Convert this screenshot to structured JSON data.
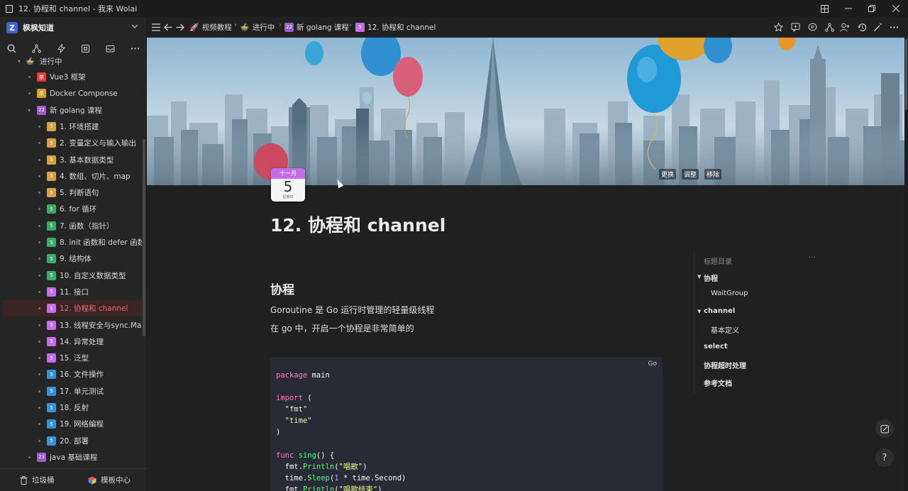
{
  "window": {
    "title": "12. 协程和 channel - 我来 Wolai",
    "controls": [
      "layout-icon",
      "minimize-icon",
      "restore-icon",
      "close-icon"
    ]
  },
  "sidebar": {
    "workspace_name": "枫枫知道",
    "partial_top_item": "进行中",
    "items": [
      {
        "label": "Vue3 框架",
        "icon_color": "#e23d3d",
        "icon_text": "禁"
      },
      {
        "label": "Docker Componse",
        "icon_color": "#c9a227",
        "icon_text": "奖"
      },
      {
        "label": "新 golang 课程",
        "icon_color": "#9b5cc9",
        "icon_text": "22"
      },
      {
        "label": "1. 环境搭建",
        "icon_color": "#d4a24a",
        "icon_text": "5"
      },
      {
        "label": "2. 变量定义与输入输出",
        "icon_color": "#d4a24a",
        "icon_text": "5"
      },
      {
        "label": "3. 基本数据类型",
        "icon_color": "#d4a24a",
        "icon_text": "5"
      },
      {
        "label": "4. 数组、切片、map",
        "icon_color": "#d4a24a",
        "icon_text": "5"
      },
      {
        "label": "5. 判断语句",
        "icon_color": "#d4a24a",
        "icon_text": "5"
      },
      {
        "label": "6. for 循环",
        "icon_color": "#3fa86a",
        "icon_text": "5"
      },
      {
        "label": "7. 函数（指针）",
        "icon_color": "#3fa86a",
        "icon_text": "5"
      },
      {
        "label": "8. init 函数和 defer 函数",
        "icon_color": "#3fa86a",
        "icon_text": "5"
      },
      {
        "label": "9. 结构体",
        "icon_color": "#3fa86a",
        "icon_text": "5"
      },
      {
        "label": "10. 自定义数据类型",
        "icon_color": "#3fa86a",
        "icon_text": "5"
      },
      {
        "label": "11. 接口",
        "icon_color": "#c36ee6",
        "icon_text": "5"
      },
      {
        "label": "12. 协程和 channel",
        "icon_color": "#c36ee6",
        "icon_text": "5"
      },
      {
        "label": "13. 线程安全与sync.Map",
        "icon_color": "#c36ee6",
        "icon_text": "5"
      },
      {
        "label": "14. 异常处理",
        "icon_color": "#c36ee6",
        "icon_text": "5"
      },
      {
        "label": "15. 泛型",
        "icon_color": "#c36ee6",
        "icon_text": "5"
      },
      {
        "label": "16. 文件操作",
        "icon_color": "#3d8fd6",
        "icon_text": "5"
      },
      {
        "label": "17. 单元测试",
        "icon_color": "#3d8fd6",
        "icon_text": "5"
      },
      {
        "label": "18. 反射",
        "icon_color": "#3d8fd6",
        "icon_text": "5"
      },
      {
        "label": "19. 网络编程",
        "icon_color": "#3d8fd6",
        "icon_text": "5"
      },
      {
        "label": "20. 部署",
        "icon_color": "#3d8fd6",
        "icon_text": "5"
      },
      {
        "label": "java 基础课程",
        "icon_color": "#9b5cc9",
        "icon_text": "23"
      }
    ],
    "footer": {
      "trash": "垃圾桶",
      "templates": "模板中心"
    }
  },
  "breadcrumb": [
    {
      "label": "视频教程",
      "icon": "rocket-icon"
    },
    {
      "label": "进行中",
      "icon": "bowl-icon"
    },
    {
      "label": "新 golang 课程",
      "icon": "calendar-icon",
      "icon_text": "22"
    },
    {
      "label": "12. 协程和 channel",
      "icon": "calendar-icon",
      "icon_text": "5"
    }
  ],
  "banner": {
    "actions": [
      "更换",
      "调整",
      "移除"
    ]
  },
  "page_icon": {
    "month": "十一月",
    "day": "5",
    "weekday": "星期日"
  },
  "document": {
    "title": "12. 协程和 channel",
    "section_heading": "协程",
    "paragraphs": [
      "Goroutine 是 Go 运行时管理的轻量级线程",
      "在 go 中，开启一个协程是非常简单的"
    ],
    "code": {
      "language": "Go",
      "lines": [
        [
          {
            "t": "package",
            "c": "kw"
          },
          {
            "t": " main",
            "c": ""
          }
        ],
        [],
        [
          {
            "t": "import",
            "c": "kw"
          },
          {
            "t": " (",
            "c": ""
          }
        ],
        [
          {
            "t": "  ",
            "c": ""
          },
          {
            "t": "\"fmt\"",
            "c": "str"
          }
        ],
        [
          {
            "t": "  ",
            "c": ""
          },
          {
            "t": "\"time\"",
            "c": "str"
          }
        ],
        [
          {
            "t": ")",
            "c": ""
          }
        ],
        [],
        [
          {
            "t": "func",
            "c": "kw"
          },
          {
            "t": " ",
            "c": ""
          },
          {
            "t": "sing",
            "c": "fn"
          },
          {
            "t": "() {",
            "c": ""
          }
        ],
        [
          {
            "t": "  fmt.",
            "c": ""
          },
          {
            "t": "Println",
            "c": "fn"
          },
          {
            "t": "(",
            "c": ""
          },
          {
            "t": "\"唱歌\"",
            "c": "str"
          },
          {
            "t": ")",
            "c": ""
          }
        ],
        [
          {
            "t": "  time.",
            "c": ""
          },
          {
            "t": "Sleep",
            "c": "fn"
          },
          {
            "t": "(",
            "c": ""
          },
          {
            "t": "1",
            "c": "num"
          },
          {
            "t": " * time.Second)",
            "c": ""
          }
        ],
        [
          {
            "t": "  fmt.",
            "c": ""
          },
          {
            "t": "Println",
            "c": "fn"
          },
          {
            "t": "(",
            "c": ""
          },
          {
            "t": "\"唱歌结束\"",
            "c": "str"
          },
          {
            "t": ")",
            "c": ""
          }
        ]
      ]
    }
  },
  "outline": {
    "title": "标题目录",
    "items": [
      {
        "label": "协程",
        "bold": true,
        "collapsible": true
      },
      {
        "label": "WaitGroup",
        "bold": false,
        "collapsible": false
      },
      {
        "label": "channel",
        "bold": true,
        "collapsible": true
      },
      {
        "label": "基本定义",
        "bold": false,
        "collapsible": false
      },
      {
        "label": "select",
        "bold": true,
        "collapsible": false
      },
      {
        "label": "协程超时处理",
        "bold": true,
        "collapsible": false
      },
      {
        "label": "参考文档",
        "bold": true,
        "collapsible": false
      }
    ]
  },
  "floating": {
    "help": "?"
  }
}
